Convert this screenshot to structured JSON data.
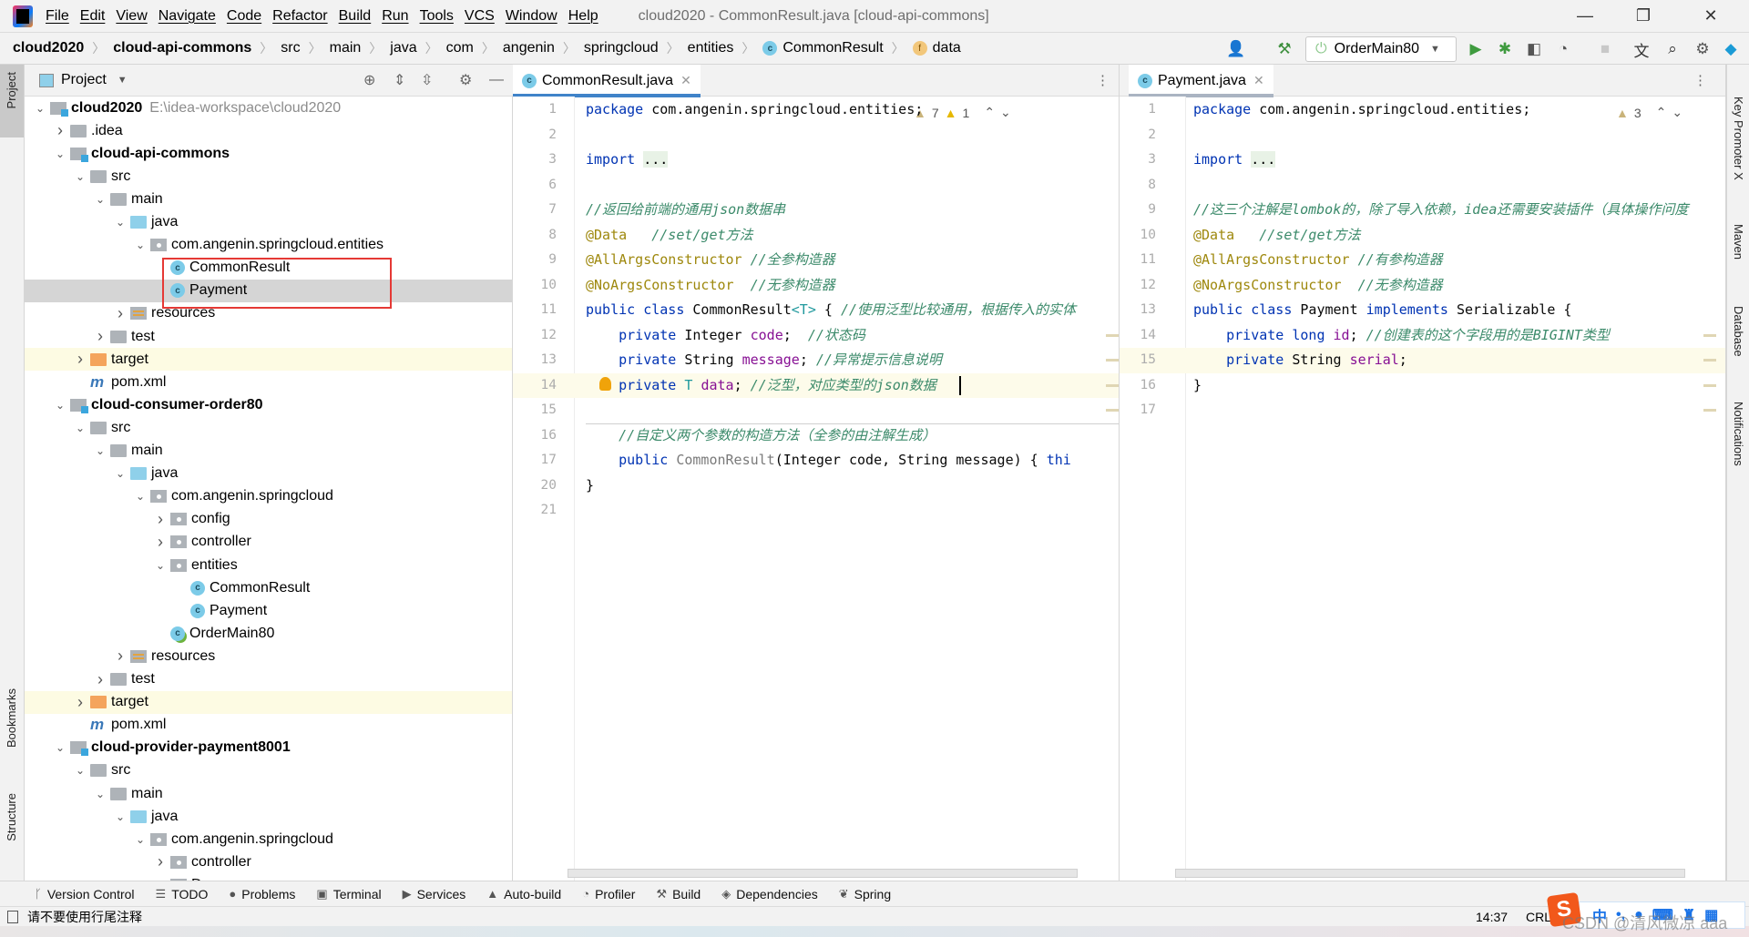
{
  "window": {
    "title": "cloud2020 - CommonResult.java [cloud-api-commons]",
    "menu": [
      "File",
      "Edit",
      "View",
      "Navigate",
      "Code",
      "Refactor",
      "Build",
      "Run",
      "Tools",
      "VCS",
      "Window",
      "Help"
    ],
    "controls": {
      "minimize": "—",
      "maximize": "❐",
      "close": "✕"
    }
  },
  "breadcrumb": [
    {
      "label": "cloud2020",
      "bold": true
    },
    {
      "label": "cloud-api-commons",
      "bold": true
    },
    {
      "label": "src"
    },
    {
      "label": "main"
    },
    {
      "label": "java"
    },
    {
      "label": "com"
    },
    {
      "label": "angenin"
    },
    {
      "label": "springcloud"
    },
    {
      "label": "entities"
    },
    {
      "label": "CommonResult",
      "icon": "class-icon"
    },
    {
      "label": "data",
      "icon": "field-icon"
    }
  ],
  "toolbar": {
    "run_config": "OrderMain80",
    "icons": [
      "user-icon",
      "build-hammer-icon",
      "run-icon",
      "debug-icon",
      "coverage-icon",
      "profile-icon",
      "stop-icon",
      "translate-icon",
      "search-icon",
      "settings-icon",
      "toolbox-icon"
    ]
  },
  "left_strip": {
    "project": "Project",
    "bookmarks": "Bookmarks",
    "structure": "Structure"
  },
  "right_strip": {
    "key_promoter": "Key Promoter X",
    "maven": "Maven",
    "database": "Database",
    "notifications": "Notifications"
  },
  "project_panel": {
    "title": "Project",
    "tree": [
      {
        "level": 0,
        "arrow": "open",
        "icon": "module",
        "label": "cloud2020",
        "bold": true,
        "path": "E:\\idea-workspace\\cloud2020"
      },
      {
        "level": 1,
        "arrow": "closed",
        "icon": "folder",
        "label": ".idea"
      },
      {
        "level": 1,
        "arrow": "open",
        "icon": "module",
        "label": "cloud-api-commons",
        "bold": true
      },
      {
        "level": 2,
        "arrow": "open",
        "icon": "folder",
        "label": "src"
      },
      {
        "level": 3,
        "arrow": "open",
        "icon": "folder",
        "label": "main"
      },
      {
        "level": 4,
        "arrow": "open",
        "icon": "folder blue",
        "label": "java"
      },
      {
        "level": 5,
        "arrow": "open",
        "icon": "pkg",
        "label": "com.angenin.springcloud.entities"
      },
      {
        "level": 6,
        "arrow": "none",
        "icon": "cls",
        "label": "CommonResult"
      },
      {
        "level": 6,
        "arrow": "none",
        "icon": "cls",
        "label": "Payment",
        "selected": true
      },
      {
        "level": 4,
        "arrow": "closed",
        "icon": "res",
        "label": "resources"
      },
      {
        "level": 3,
        "arrow": "closed",
        "icon": "folder",
        "label": "test"
      },
      {
        "level": 2,
        "arrow": "closed",
        "icon": "folder orange",
        "label": "target",
        "excluded": true
      },
      {
        "level": 2,
        "arrow": "none",
        "icon": "mvn",
        "label": "pom.xml"
      },
      {
        "level": 1,
        "arrow": "open",
        "icon": "module",
        "label": "cloud-consumer-order80",
        "bold": true
      },
      {
        "level": 2,
        "arrow": "open",
        "icon": "folder",
        "label": "src"
      },
      {
        "level": 3,
        "arrow": "open",
        "icon": "folder",
        "label": "main"
      },
      {
        "level": 4,
        "arrow": "open",
        "icon": "folder blue",
        "label": "java"
      },
      {
        "level": 5,
        "arrow": "open",
        "icon": "pkg",
        "label": "com.angenin.springcloud"
      },
      {
        "level": 6,
        "arrow": "closed",
        "icon": "pkg",
        "label": "config"
      },
      {
        "level": 6,
        "arrow": "closed",
        "icon": "pkg",
        "label": "controller"
      },
      {
        "level": 6,
        "arrow": "open",
        "icon": "pkg",
        "label": "entities"
      },
      {
        "level": 7,
        "arrow": "none",
        "icon": "cls",
        "label": "CommonResult"
      },
      {
        "level": 7,
        "arrow": "none",
        "icon": "cls",
        "label": "Payment"
      },
      {
        "level": 6,
        "arrow": "none",
        "icon": "boot",
        "label": "OrderMain80"
      },
      {
        "level": 4,
        "arrow": "closed",
        "icon": "res",
        "label": "resources"
      },
      {
        "level": 3,
        "arrow": "closed",
        "icon": "folder",
        "label": "test"
      },
      {
        "level": 2,
        "arrow": "closed",
        "icon": "folder orange",
        "label": "target",
        "excluded": true
      },
      {
        "level": 2,
        "arrow": "none",
        "icon": "mvn",
        "label": "pom.xml"
      },
      {
        "level": 1,
        "arrow": "open",
        "icon": "module",
        "label": "cloud-provider-payment8001",
        "bold": true
      },
      {
        "level": 2,
        "arrow": "open",
        "icon": "folder",
        "label": "src"
      },
      {
        "level": 3,
        "arrow": "open",
        "icon": "folder",
        "label": "main"
      },
      {
        "level": 4,
        "arrow": "open",
        "icon": "folder blue",
        "label": "java"
      },
      {
        "level": 5,
        "arrow": "open",
        "icon": "pkg",
        "label": "com.angenin.springcloud"
      },
      {
        "level": 6,
        "arrow": "closed",
        "icon": "pkg",
        "label": "controller"
      },
      {
        "level": 6,
        "arrow": "closed",
        "icon": "pkg",
        "label": "D"
      }
    ]
  },
  "editors": [
    {
      "tab": "CommonResult.java",
      "active": true,
      "warnings": "7",
      "weak_warnings": "1",
      "current_line": 14,
      "lines": [
        {
          "n": "1",
          "tokens": [
            [
              "kw",
              "package "
            ],
            [
              "plain",
              "com.angenin.springcloud.entities;"
            ]
          ]
        },
        {
          "n": "2",
          "tokens": []
        },
        {
          "n": "3",
          "tokens": [
            [
              "kw",
              "import "
            ],
            [
              "fold",
              "..."
            ]
          ]
        },
        {
          "n": "6",
          "tokens": []
        },
        {
          "n": "7",
          "tokens": [
            [
              "cmt",
              "//返回给前端的通用json数据串"
            ]
          ]
        },
        {
          "n": "8",
          "tokens": [
            [
              "ann",
              "@Data   "
            ],
            [
              "cmt",
              "//set/get方法"
            ]
          ]
        },
        {
          "n": "9",
          "tokens": [
            [
              "ann",
              "@AllArgsConstructor "
            ],
            [
              "cmt",
              "//全参构造器"
            ]
          ]
        },
        {
          "n": "10",
          "tokens": [
            [
              "ann",
              "@NoArgsConstructor  "
            ],
            [
              "cmt",
              "//无参构造器"
            ]
          ]
        },
        {
          "n": "11",
          "tokens": [
            [
              "kw",
              "public class "
            ],
            [
              "plain",
              "CommonResult"
            ],
            [
              "tp",
              "<T>"
            ],
            [
              "plain",
              " { "
            ],
            [
              "cmt",
              "//使用泛型比较通用，根据传入的实体"
            ]
          ]
        },
        {
          "n": "12",
          "tokens": [
            [
              "plain",
              "    "
            ],
            [
              "kw",
              "private "
            ],
            [
              "plain",
              "Integer "
            ],
            [
              "fld",
              "code"
            ],
            [
              "plain",
              ";  "
            ],
            [
              "cmt",
              "//状态码"
            ]
          ]
        },
        {
          "n": "13",
          "tokens": [
            [
              "plain",
              "    "
            ],
            [
              "kw",
              "private "
            ],
            [
              "plain",
              "String "
            ],
            [
              "fld",
              "message"
            ],
            [
              "plain",
              "; "
            ],
            [
              "cmt",
              "//异常提示信息说明"
            ]
          ]
        },
        {
          "n": "14",
          "tokens": [
            [
              "plain",
              "    "
            ],
            [
              "kw",
              "private "
            ],
            [
              "tp",
              "T "
            ],
            [
              "fld",
              "data"
            ],
            [
              "plain",
              "; "
            ],
            [
              "cmt",
              "//泛型，对应类型的json数据"
            ]
          ]
        },
        {
          "n": "15",
          "tokens": []
        },
        {
          "n": "16",
          "tokens": [
            [
              "plain",
              "    "
            ],
            [
              "cmt",
              "//自定义两个参数的构造方法（全参的由注解生成）"
            ]
          ]
        },
        {
          "n": "17",
          "tokens": [
            [
              "plain",
              "    "
            ],
            [
              "kw",
              "public "
            ],
            [
              "gray",
              "CommonResult"
            ],
            [
              "plain",
              "(Integer code, String message) { "
            ],
            [
              "kw",
              "thi"
            ]
          ]
        },
        {
          "n": "20",
          "tokens": [
            [
              "plain",
              "}"
            ]
          ]
        },
        {
          "n": "21",
          "tokens": []
        }
      ]
    },
    {
      "tab": "Payment.java",
      "active": false,
      "warnings": "3",
      "current_line": 15,
      "lines": [
        {
          "n": "1",
          "tokens": [
            [
              "kw",
              "package "
            ],
            [
              "plain",
              "com.angenin.springcloud.entities;"
            ]
          ]
        },
        {
          "n": "2",
          "tokens": []
        },
        {
          "n": "3",
          "tokens": [
            [
              "kw",
              "import "
            ],
            [
              "fold",
              "..."
            ]
          ]
        },
        {
          "n": "8",
          "tokens": []
        },
        {
          "n": "9",
          "tokens": [
            [
              "cmt",
              "//这三个注解是lombok的，除了导入依赖，idea还需要安装插件（具体操作问度"
            ]
          ]
        },
        {
          "n": "10",
          "tokens": [
            [
              "ann",
              "@Data   "
            ],
            [
              "cmt",
              "//set/get方法"
            ]
          ]
        },
        {
          "n": "11",
          "tokens": [
            [
              "ann",
              "@AllArgsConstructor "
            ],
            [
              "cmt",
              "//有参构造器"
            ]
          ]
        },
        {
          "n": "12",
          "tokens": [
            [
              "ann",
              "@NoArgsConstructor  "
            ],
            [
              "cmt",
              "//无参构造器"
            ]
          ]
        },
        {
          "n": "13",
          "tokens": [
            [
              "kw",
              "public class "
            ],
            [
              "plain",
              "Payment "
            ],
            [
              "kw",
              "implements "
            ],
            [
              "plain",
              "Serializable {"
            ]
          ]
        },
        {
          "n": "14",
          "tokens": [
            [
              "plain",
              "    "
            ],
            [
              "kw",
              "private long "
            ],
            [
              "fld",
              "id"
            ],
            [
              "plain",
              "; "
            ],
            [
              "cmt",
              "//创建表的这个字段用的是BIGINT类型"
            ]
          ]
        },
        {
          "n": "15",
          "tokens": [
            [
              "plain",
              "    "
            ],
            [
              "kw",
              "private "
            ],
            [
              "plain",
              "String "
            ],
            [
              "fld",
              "serial"
            ],
            [
              "plain",
              ";"
            ]
          ]
        },
        {
          "n": "16",
          "tokens": [
            [
              "plain",
              "}"
            ]
          ]
        },
        {
          "n": "17",
          "tokens": []
        }
      ]
    }
  ],
  "bottom_tools": [
    {
      "icon": "version-control-icon",
      "glyph": "ᚴ",
      "label": "Version Control"
    },
    {
      "icon": "todo-icon",
      "glyph": "☰",
      "label": "TODO"
    },
    {
      "icon": "problems-icon",
      "glyph": "●",
      "label": "Problems"
    },
    {
      "icon": "terminal-icon",
      "glyph": "▣",
      "label": "Terminal"
    },
    {
      "icon": "services-icon",
      "glyph": "▶",
      "label": "Services"
    },
    {
      "icon": "auto-build-icon",
      "glyph": "▲",
      "label": "Auto-build"
    },
    {
      "icon": "profiler-icon",
      "glyph": "◔",
      "label": "Profiler"
    },
    {
      "icon": "build-icon",
      "glyph": "⚒",
      "label": "Build"
    },
    {
      "icon": "dependencies-icon",
      "glyph": "◈",
      "label": "Dependencies"
    },
    {
      "icon": "spring-icon",
      "glyph": "❦",
      "label": "Spring"
    }
  ],
  "status": {
    "message": "请不要使用行尾注释",
    "position": "14:37",
    "line_sep": "CRL"
  },
  "ime": {
    "mode": "中",
    "watermark": "CSDN @清风微凉 aaa"
  },
  "colors": {
    "accent": "#4083c9",
    "selection": "#d5d5d5",
    "current_line": "#fdfbea",
    "highlight_box": "#e53935"
  }
}
